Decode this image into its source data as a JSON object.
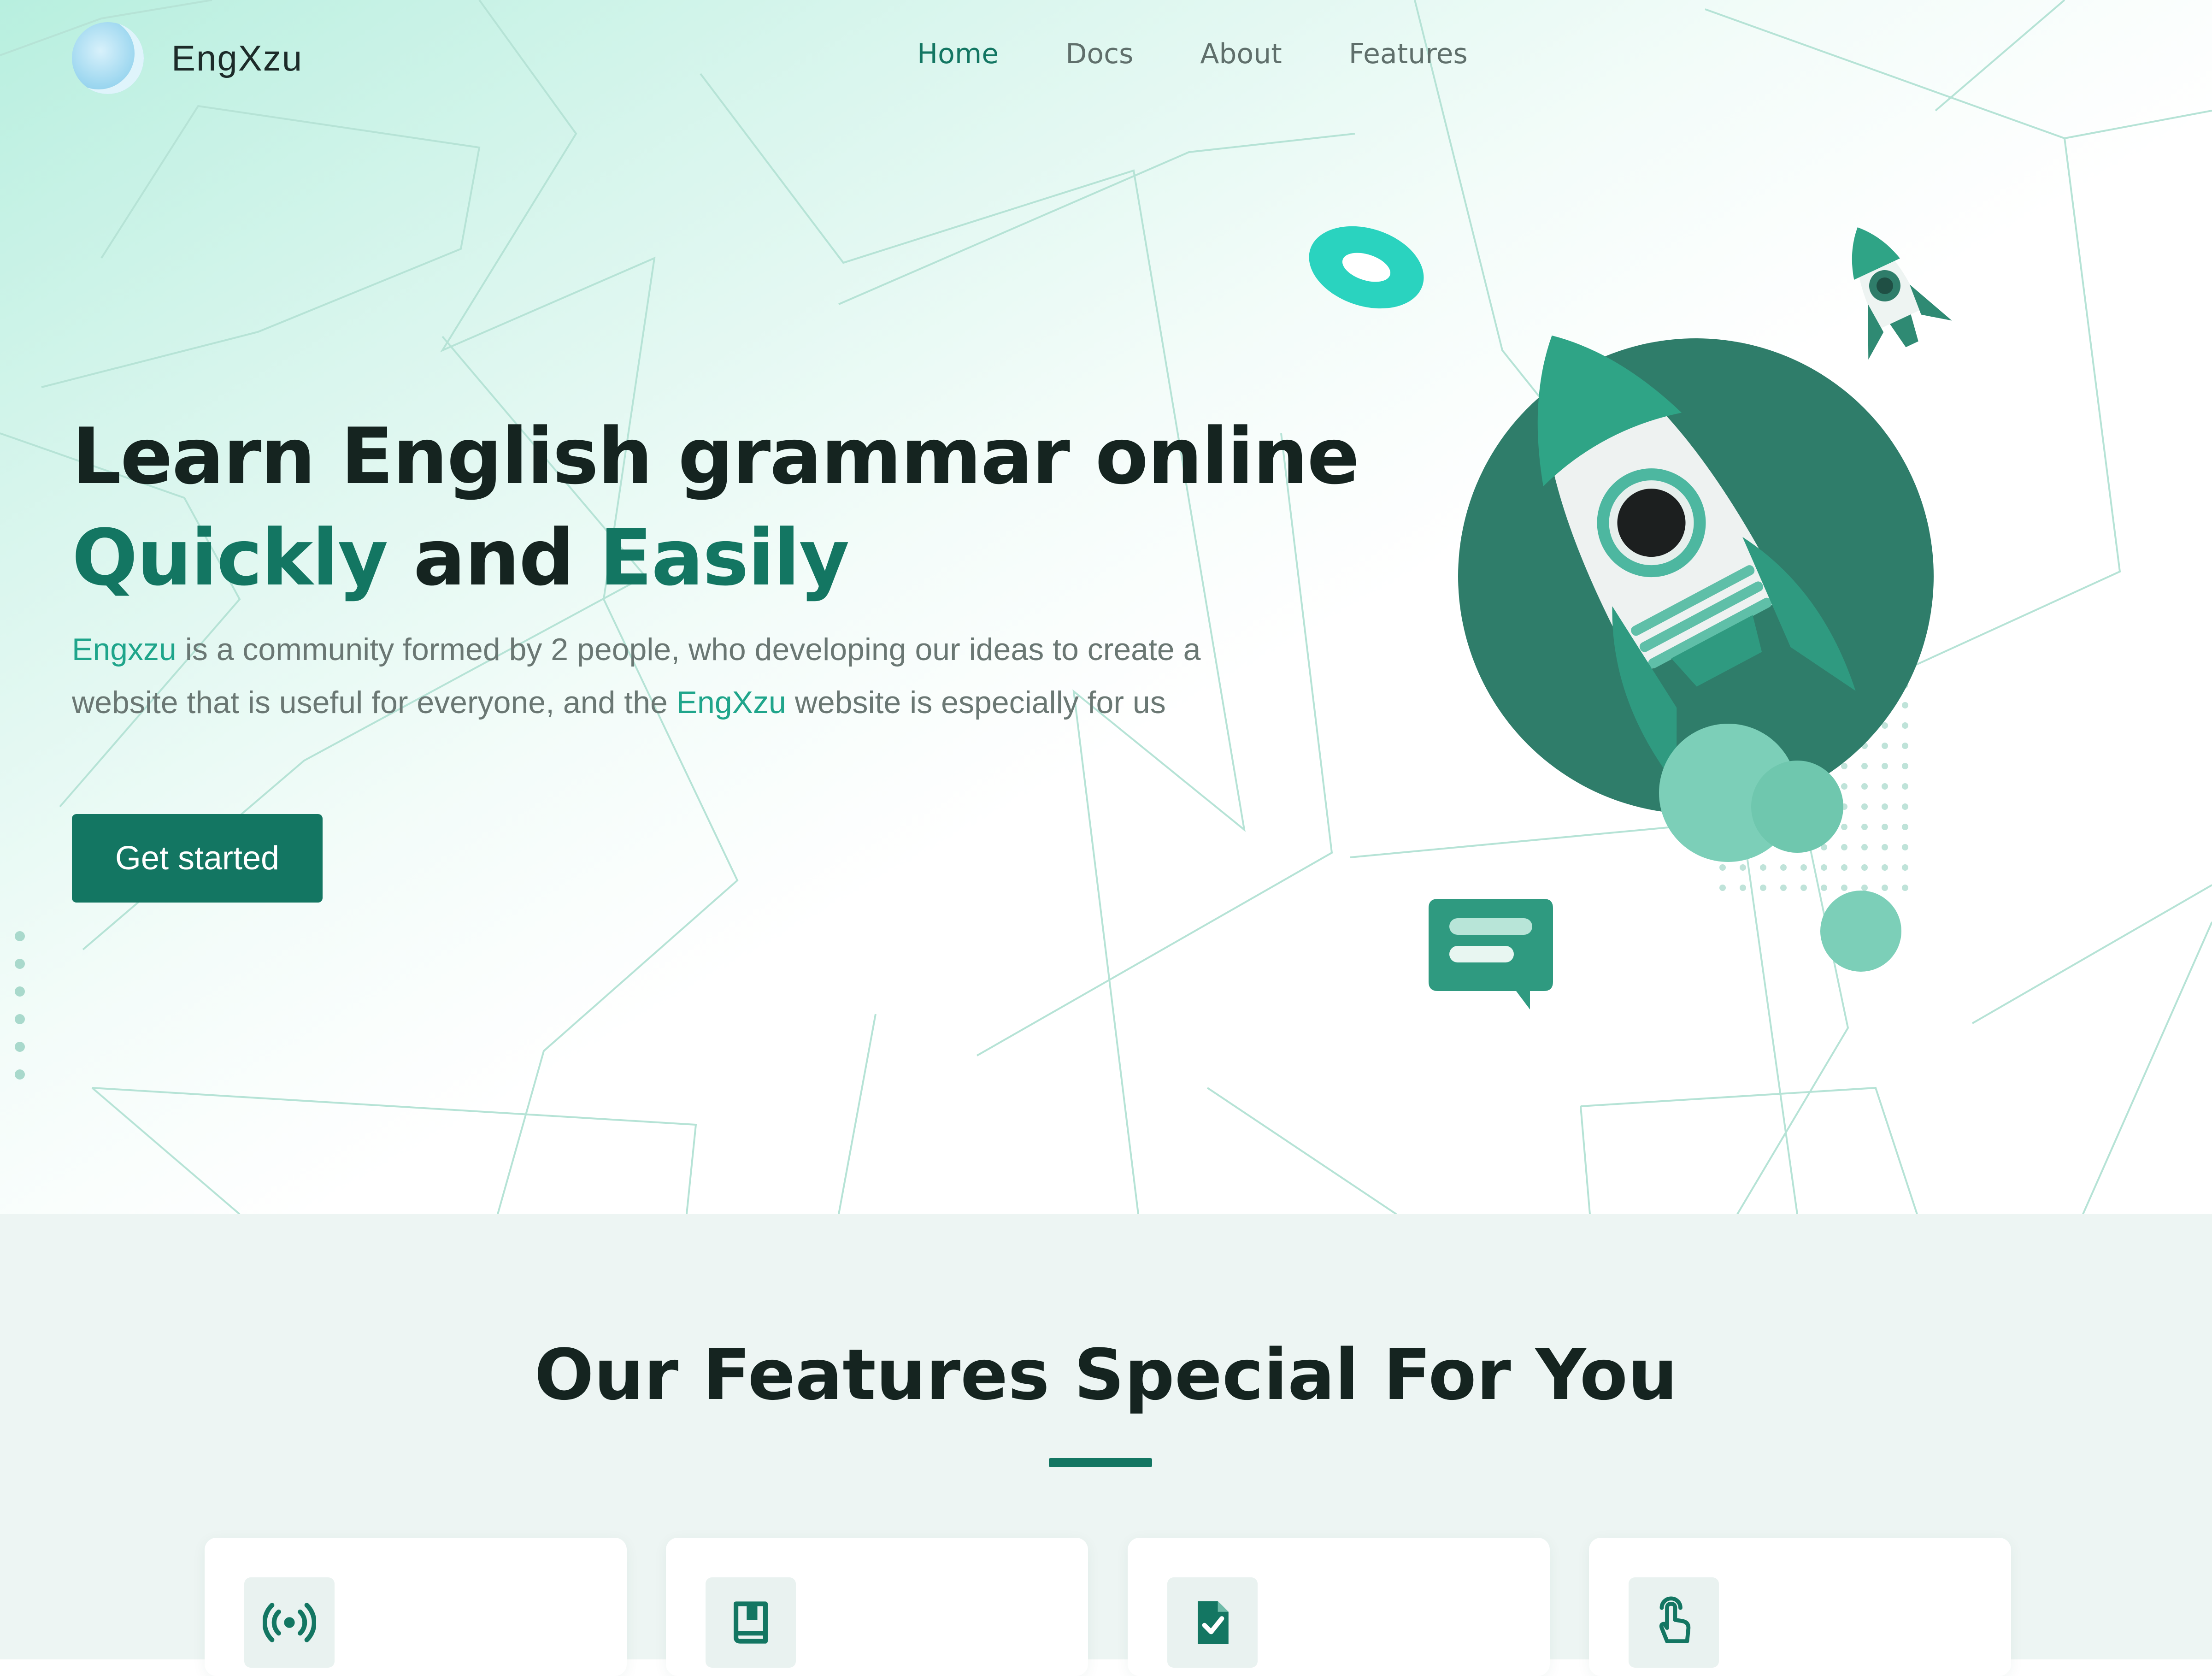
{
  "brand": {
    "name": "EngXzu"
  },
  "nav": {
    "items": [
      {
        "label": "Home",
        "active": true
      },
      {
        "label": "Docs",
        "active": false
      },
      {
        "label": "About",
        "active": false
      },
      {
        "label": "Features",
        "active": false
      }
    ]
  },
  "hero": {
    "headline_line1": "Learn English grammar online",
    "headline_word1": "Quickly",
    "headline_and": " and ",
    "headline_word2": "Easily",
    "intro_brand1": "Engxzu",
    "intro_part1": " is a community formed by 2 people, who developing our ideas to create a website that is useful for everyone, and the ",
    "intro_brand2": "EngXzu",
    "intro_part2": " website is especially for us",
    "cta_label": "Get started"
  },
  "features": {
    "title": "Our Features Special For You",
    "cards": [
      {
        "icon": "broadcast-icon"
      },
      {
        "icon": "book-icon"
      },
      {
        "icon": "file-check-icon"
      },
      {
        "icon": "pointer-hand-icon"
      }
    ]
  },
  "colors": {
    "accent": "#137662",
    "accent_light": "#1fa58b",
    "heading": "#152420",
    "body_text": "#6a7773",
    "features_bg": "#edf5f3"
  }
}
